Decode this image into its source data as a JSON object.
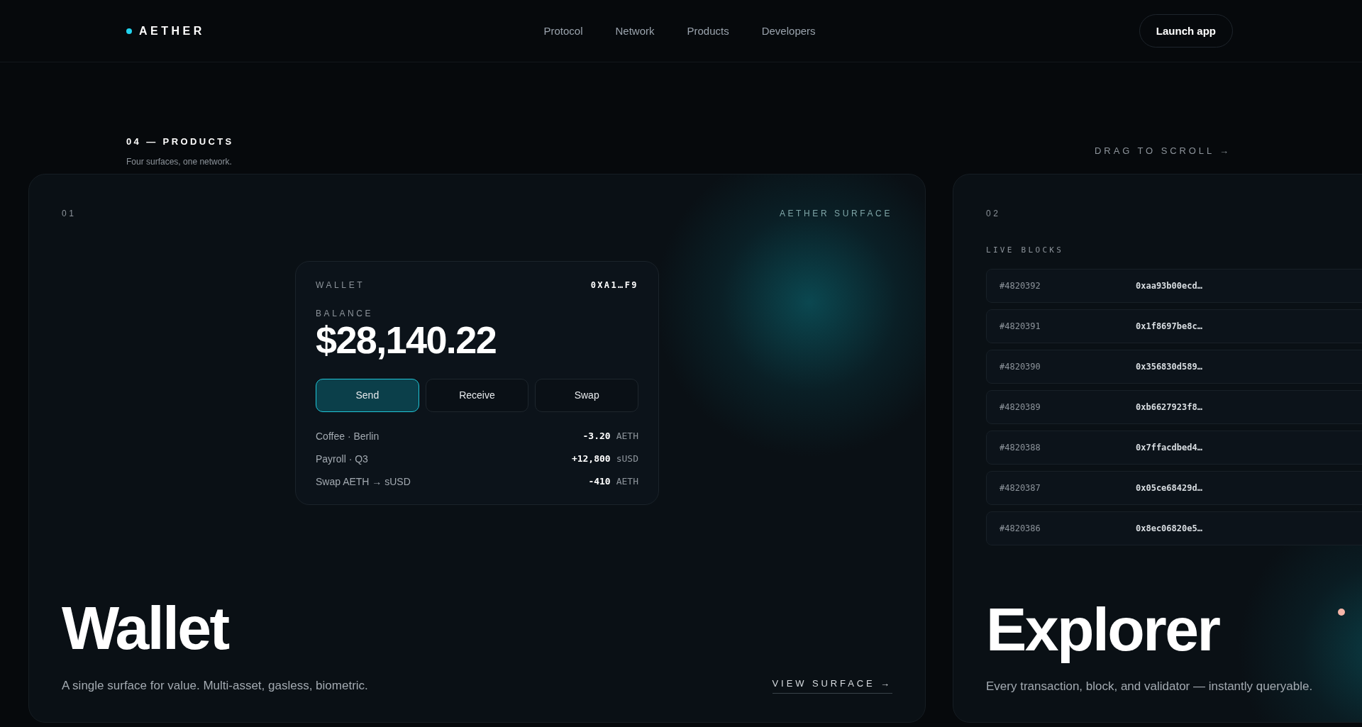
{
  "nav": {
    "logo": "AETHER",
    "links": [
      "Protocol",
      "Network",
      "Products",
      "Developers"
    ],
    "cta": "Launch app"
  },
  "section": {
    "label": "04 — PRODUCTS",
    "subtitle": "Four surfaces, one network.",
    "hint": "DRAG TO SCROLL →"
  },
  "cards": [
    {
      "kind": "wallet",
      "index": "01",
      "tag": "AETHER SURFACE",
      "title": "Wallet",
      "description": "A single surface for value. Multi-asset, gasless, biometric.",
      "link": "VIEW SURFACE →",
      "wallet": {
        "label": "WALLET",
        "address": "0XA1…F9",
        "balance_label": "BALANCE",
        "balance": "$28,140.22",
        "actions": [
          {
            "label": "Send",
            "selected": true
          },
          {
            "label": "Receive",
            "selected": false
          },
          {
            "label": "Swap",
            "selected": false
          }
        ],
        "transactions": [
          {
            "name": "Coffee · Berlin",
            "amount": "-3.20",
            "unit": "AETH"
          },
          {
            "name": "Payroll · Q3",
            "amount": "+12,800",
            "unit": "sUSD"
          },
          {
            "name": "Swap AETH → sUSD",
            "amount": "-410",
            "unit": "AETH"
          }
        ]
      }
    },
    {
      "kind": "explorer",
      "index": "02",
      "title": "Explorer",
      "description": "Every transaction, block, and validator — instantly queryable.",
      "blocks_label": "LIVE BLOCKS",
      "blocks": [
        {
          "block": "#4820392",
          "hash": "0xaa93b00ecd…"
        },
        {
          "block": "#4820391",
          "hash": "0x1f8697be8c…"
        },
        {
          "block": "#4820390",
          "hash": "0x356830d589…"
        },
        {
          "block": "#4820389",
          "hash": "0xb6627923f8…"
        },
        {
          "block": "#4820388",
          "hash": "0x7ffacdbed4…"
        },
        {
          "block": "#4820387",
          "hash": "0x05ce68429d…"
        },
        {
          "block": "#4820386",
          "hash": "0x8ec06820e5…"
        }
      ]
    }
  ]
}
